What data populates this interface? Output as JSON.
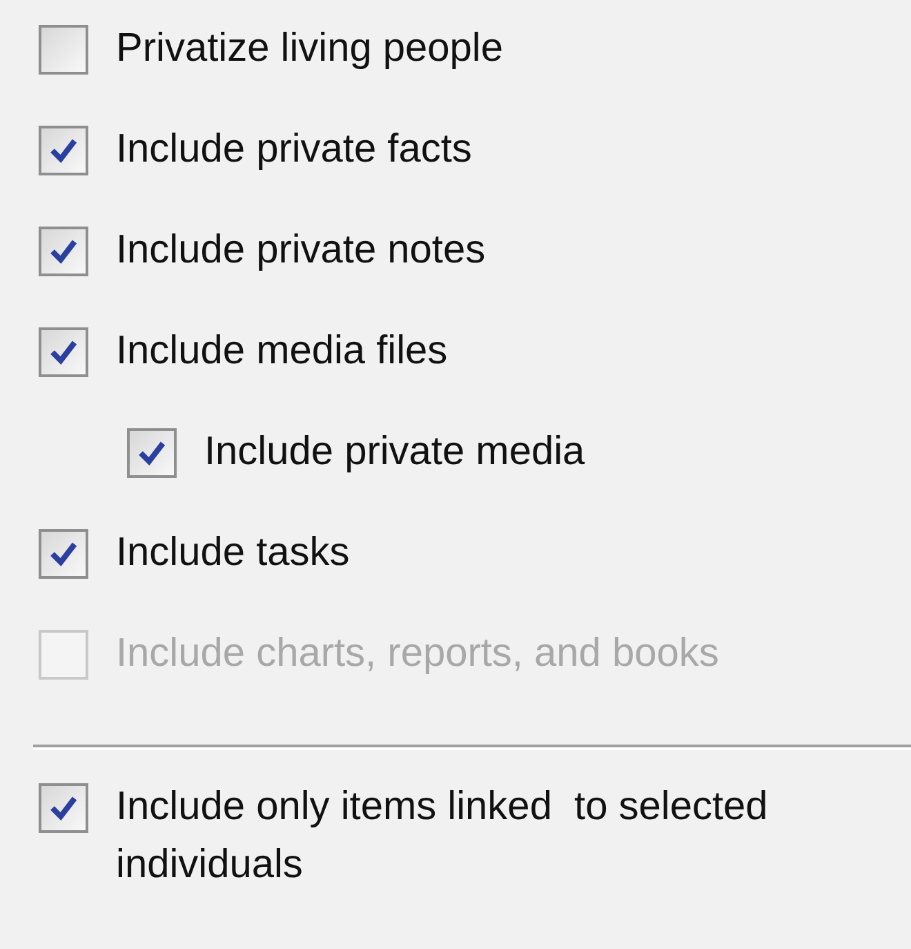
{
  "groups": [
    {
      "items": [
        {
          "label": "Privatize living people",
          "checked": false,
          "disabled": false
        },
        {
          "label": "Include private facts",
          "checked": true,
          "disabled": false
        },
        {
          "label": "Include private notes",
          "checked": true,
          "disabled": false
        },
        {
          "label": "Include media files",
          "checked": true,
          "disabled": false,
          "children": [
            {
              "label": "Include private media",
              "checked": true,
              "disabled": false
            }
          ]
        },
        {
          "label": "Include tasks",
          "checked": true,
          "disabled": false
        },
        {
          "label": "Include charts, reports, and books",
          "checked": false,
          "disabled": true
        }
      ]
    },
    {
      "items": [
        {
          "label": "Include only items linked  to selected individuals",
          "checked": true,
          "disabled": false
        }
      ]
    }
  ]
}
